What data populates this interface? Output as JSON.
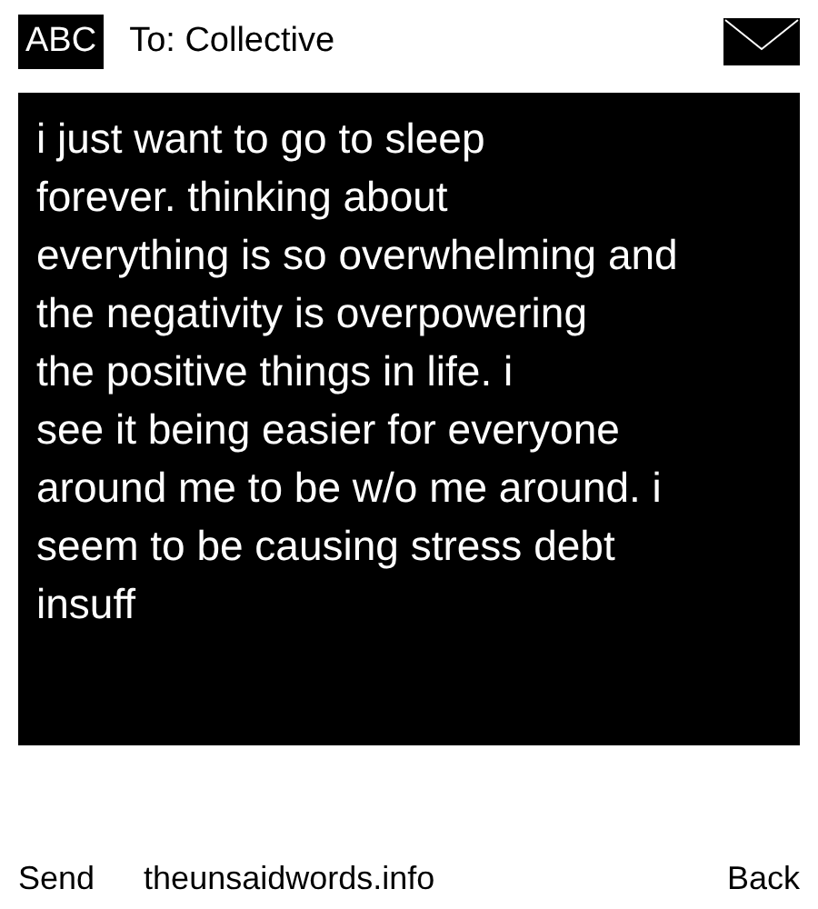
{
  "header": {
    "input_mode": "ABC",
    "recipient": "To: Collective"
  },
  "message": {
    "lines": [
      "i just want to go to sleep",
      "forever. thinking about",
      "everything is so overwhelming and",
      "the negativity is overpowering",
      "the positive things in life. i",
      "see it being easier for everyone",
      "around me to be w/o me around. i",
      "seem to be causing stress debt",
      "insuff"
    ]
  },
  "footer": {
    "left": "Send",
    "site": "theunsaidwords.info",
    "right": "Back"
  }
}
